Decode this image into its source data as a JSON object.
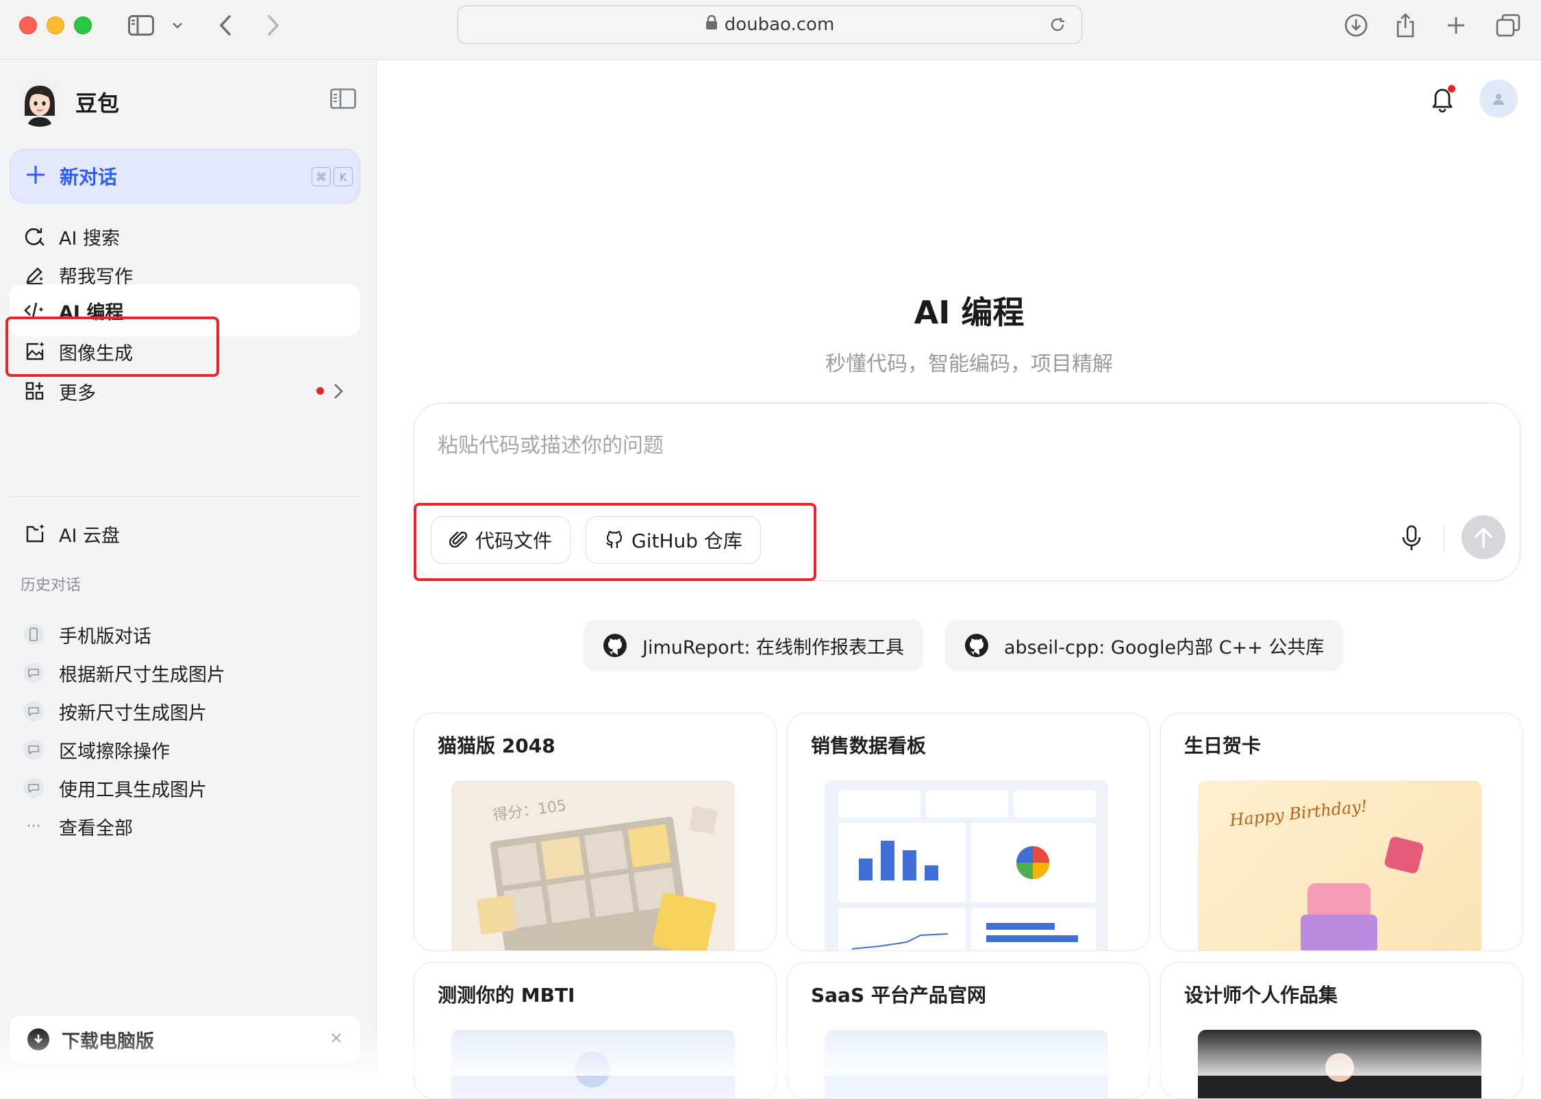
{
  "browser": {
    "url": "doubao.com"
  },
  "sidebar": {
    "app_name": "豆包",
    "new_chat": {
      "label": "新对话",
      "shortcut_cmd": "⌘",
      "shortcut_key": "K"
    },
    "nav": [
      {
        "label": "AI 搜索",
        "icon": "search-refresh-icon"
      },
      {
        "label": "帮我写作",
        "icon": "pen-sparkle-icon"
      },
      {
        "label": "AI 编程",
        "icon": "code-icon",
        "active": true
      },
      {
        "label": "图像生成",
        "icon": "image-sparkle-icon"
      },
      {
        "label": "更多",
        "icon": "apps-icon",
        "has_dot": true
      }
    ],
    "cloud": {
      "label": "AI 云盘",
      "icon": "cloud-drive-icon"
    },
    "history_title": "历史对话",
    "history": [
      {
        "label": "手机版对话",
        "icon": "phone-icon"
      },
      {
        "label": "根据新尺寸生成图片",
        "icon": "chat-bubble-icon"
      },
      {
        "label": "按新尺寸生成图片",
        "icon": "chat-bubble-icon"
      },
      {
        "label": "区域擦除操作",
        "icon": "chat-bubble-icon"
      },
      {
        "label": "使用工具生成图片",
        "icon": "chat-bubble-icon"
      },
      {
        "label": "查看全部",
        "icon": "ellipsis-icon"
      }
    ],
    "download": {
      "label": "下载电脑版"
    }
  },
  "main": {
    "title": "AI 编程",
    "subtitle": "秒懂代码，智能编码，项目精解",
    "input": {
      "placeholder": "粘贴代码或描述你的问题",
      "chips": [
        {
          "label": "代码文件",
          "icon": "paperclip-icon"
        },
        {
          "label": "GitHub 仓库",
          "icon": "github-icon"
        }
      ]
    },
    "repo_suggestions": [
      {
        "label": "JimuReport: 在线制作报表工具"
      },
      {
        "label": "abseil-cpp: Google内部 C++ 公共库"
      }
    ],
    "cards": [
      {
        "title": "猫猫版 2048",
        "thumb_score": "得分：105"
      },
      {
        "title": "销售数据看板"
      },
      {
        "title": "生日贺卡",
        "thumb_text": "Happy Birthday!"
      },
      {
        "title": "测测你的 MBTI"
      },
      {
        "title": "SaaS 平台产品官网"
      },
      {
        "title": "设计师个人作品集"
      }
    ]
  },
  "colors": {
    "accent": "#2f5cf2",
    "highlight_red": "#e8242a",
    "sidebar_bg": "#f3f4f6"
  }
}
